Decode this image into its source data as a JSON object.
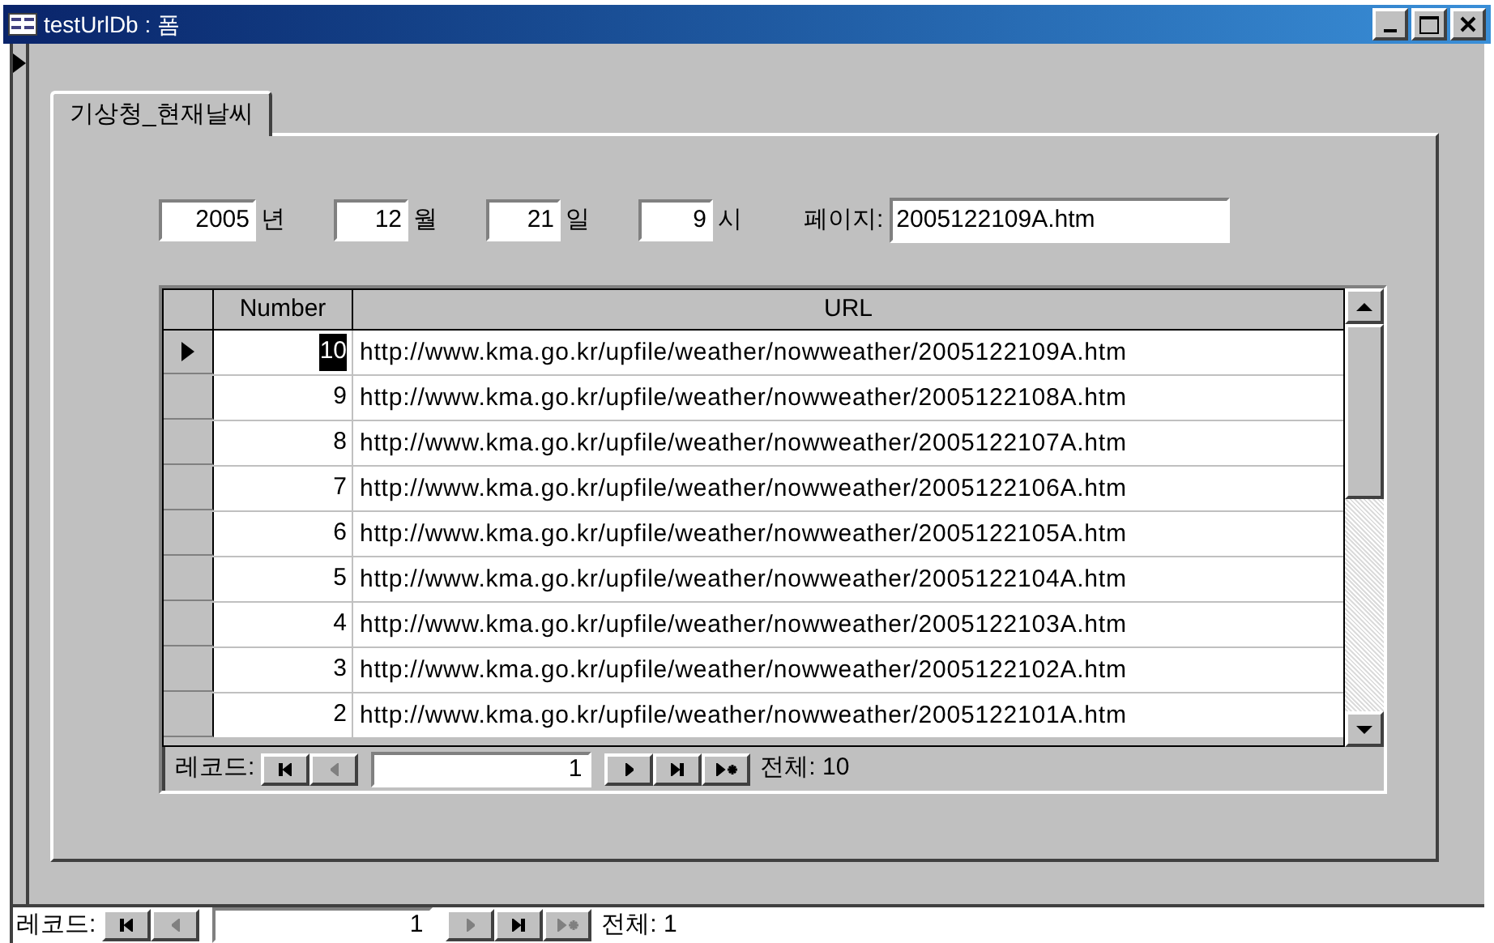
{
  "window": {
    "title": "testUrlDb : 폼"
  },
  "tabs": [
    {
      "label": "기상청_현재날씨",
      "selected": true
    }
  ],
  "date_fields": [
    {
      "value": "2005",
      "unit": "년"
    },
    {
      "value": "12",
      "unit": "월"
    },
    {
      "value": "21",
      "unit": "일"
    },
    {
      "value": "9",
      "unit": "시"
    }
  ],
  "page_field": {
    "label": "페이지:",
    "value": "2005122109A.htm"
  },
  "table": {
    "columns": [
      "Number",
      "URL"
    ],
    "rows": [
      {
        "number": "10",
        "url": "http://www.kma.go.kr/upfile/weather/nowweather/2005122109A.htm",
        "selected": true
      },
      {
        "number": "9",
        "url": "http://www.kma.go.kr/upfile/weather/nowweather/2005122108A.htm",
        "selected": false
      },
      {
        "number": "8",
        "url": "http://www.kma.go.kr/upfile/weather/nowweather/2005122107A.htm",
        "selected": false
      },
      {
        "number": "7",
        "url": "http://www.kma.go.kr/upfile/weather/nowweather/2005122106A.htm",
        "selected": false
      },
      {
        "number": "6",
        "url": "http://www.kma.go.kr/upfile/weather/nowweather/2005122105A.htm",
        "selected": false
      },
      {
        "number": "5",
        "url": "http://www.kma.go.kr/upfile/weather/nowweather/2005122104A.htm",
        "selected": false
      },
      {
        "number": "4",
        "url": "http://www.kma.go.kr/upfile/weather/nowweather/2005122103A.htm",
        "selected": false
      },
      {
        "number": "3",
        "url": "http://www.kma.go.kr/upfile/weather/nowweather/2005122102A.htm",
        "selected": false
      },
      {
        "number": "2",
        "url": "http://www.kma.go.kr/upfile/weather/nowweather/2005122101A.htm",
        "selected": false
      }
    ]
  },
  "subform_navigation": {
    "label": "레코드:",
    "value": "1",
    "total": "전체: 10",
    "buttons": [
      {
        "kind": "first",
        "disabled": false
      },
      {
        "kind": "prev",
        "disabled": true
      },
      {
        "kind": "next",
        "disabled": false
      },
      {
        "kind": "last",
        "disabled": false
      },
      {
        "kind": "new",
        "disabled": false
      }
    ]
  },
  "form_navigation": {
    "label": "레코드:",
    "value": "1",
    "total": "전체: 1",
    "buttons": [
      {
        "kind": "first",
        "disabled": false
      },
      {
        "kind": "prev",
        "disabled": true
      },
      {
        "kind": "next",
        "disabled": true
      },
      {
        "kind": "last",
        "disabled": false
      },
      {
        "kind": "new",
        "disabled": true
      }
    ]
  }
}
